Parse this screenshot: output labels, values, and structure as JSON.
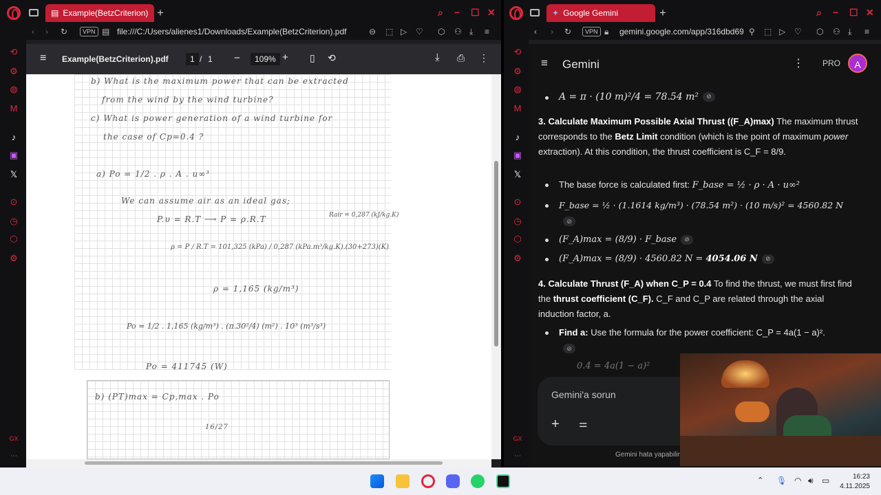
{
  "left": {
    "tab_title": "Example(BetzCriterion).pdf",
    "vpn": "VPN",
    "url": "file:///C:/Users/alienes1/Downloads/Example(BetzCriterion).pdf",
    "pdf": {
      "filename": "Example(BetzCriterion).pdf",
      "page": "1",
      "sep": "/",
      "total": "1",
      "zoom": "109%"
    },
    "doc": {
      "l1": "b) What is the maximum power that can be extracted",
      "l2": "from the wind by the wind turbine?",
      "l3": "c) What is power generation of a wind turbine for",
      "l4": "the case of Cp=0.4 ?",
      "l5": "a)   Po = 1/2 . ρ . A . u∞³",
      "l6": "We can assume air as an ideal gas;",
      "l7": "P.υ = R.T  ⟶  P = ρ.R.T",
      "l8": "Rair = 0,287 (kJ/kg.K)",
      "l9": "ρ = P / R.T = 101,325 (kPa) / 0,287 (kPa.m³/kg.K).(30+273)(K)",
      "l10": "ρ = 1,165 (kg/m³)",
      "l11": "Po = 1/2 . 1,165 (kg/m³) . (π.30²/4) (m²) . 10³ (m³/s³)",
      "l12": "Po = 411745 (W)",
      "l13": "b)   (PT)max = Cp,max . Po",
      "l14": "16/27"
    }
  },
  "right": {
    "tab_title": "Google Gemini",
    "vpn": "VPN",
    "url": "gemini.google.com/app/316dbd69",
    "gemini": {
      "title": "Gemini",
      "pro": "PRO",
      "avatar": "A"
    },
    "content": {
      "area": "A = π · (10 m)²/4 = 78.54 m²",
      "h3_bold": "3. Calculate Maximum Possible Axial Thrust ((F_A)max)",
      "h3_rest": "The maximum thrust corresponds to the",
      "betz": "Betz Limit",
      "h3_rest2": "condition (which is the point of maximum",
      "power_word": "power",
      "h3_rest3": "extraction). At this condition, the thrust coefficient is C_F = 8/9.",
      "b1_text": "The base force is calculated first:",
      "b1_math": "F_base = ½ · ρ · A · u∞²",
      "b2_math": "F_base = ½ · (1.1614 kg/m³) · (78.54 m²) · (10 m/s)² = 4560.82 N",
      "b3_math": "(F_A)max = (8/9) · F_base",
      "b4_math": "(F_A)max = (8/9) · 4560.82 N =",
      "b4_bold": "4054.06 N",
      "h4_bold": "4. Calculate Thrust (F_A) when C_P = 0.4",
      "h4_rest": "To find the thrust, we must first find the",
      "thrust_coef": "thrust coefficient (C_F).",
      "h4_rest2": "C_F and C_P are related through the axial induction factor, a.",
      "find_bold": "Find a:",
      "find_rest": "Use the formula for the power coefficient: C_P = 4a(1 − a)².",
      "partial": "0.4 = 4a(1 − a)²"
    },
    "input_placeholder": "Gemini'a sorun",
    "footer": "Gemini hata yapabilir"
  },
  "taskbar": {
    "time": "16:23",
    "date": "4.11.2025"
  },
  "colors": {
    "accent": "#e0263c",
    "tab_active": "#c21d33",
    "gemini_bg": "#131314",
    "avatar": "#a82ecf"
  }
}
